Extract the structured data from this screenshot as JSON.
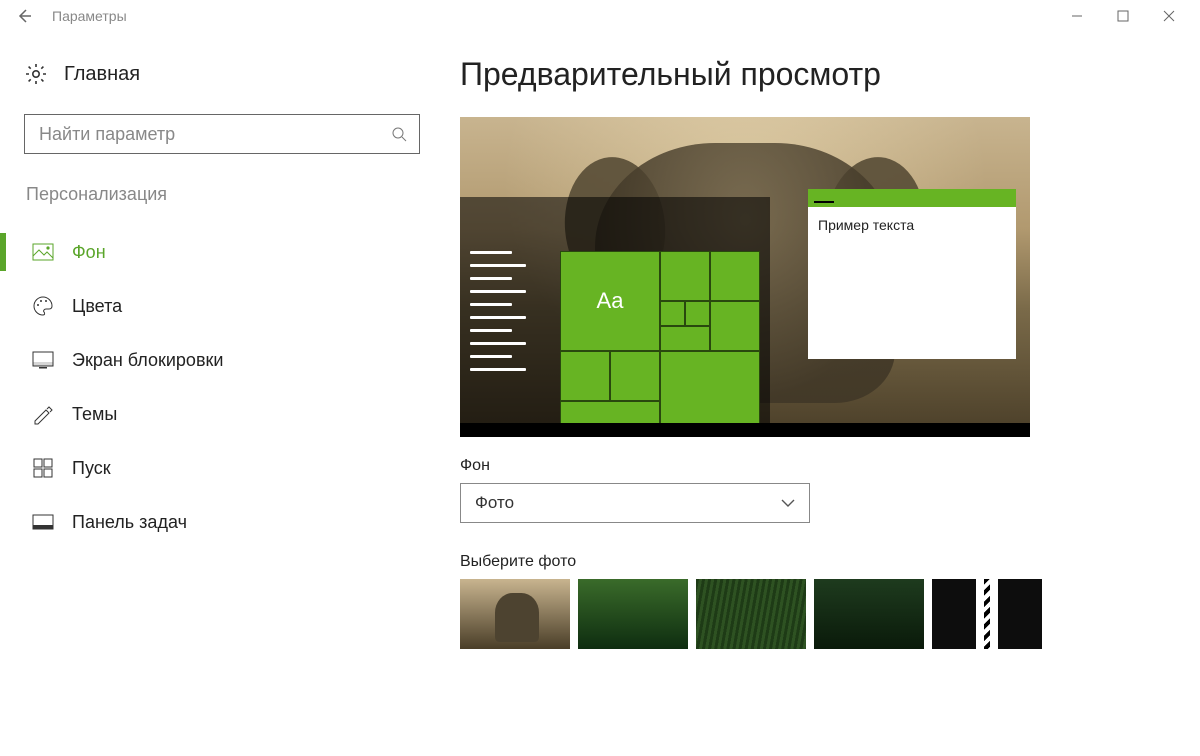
{
  "window": {
    "title": "Параметры"
  },
  "sidebar": {
    "home": "Главная",
    "search_placeholder": "Найти параметр",
    "section": "Персонализация",
    "items": [
      {
        "label": "Фон"
      },
      {
        "label": "Цвета"
      },
      {
        "label": "Экран блокировки"
      },
      {
        "label": "Темы"
      },
      {
        "label": "Пуск"
      },
      {
        "label": "Панель задач"
      }
    ]
  },
  "content": {
    "heading": "Предварительный просмотр",
    "preview_sample_text": "Пример текста",
    "preview_tile_aa": "Aa",
    "background_label": "Фон",
    "background_select_value": "Фото",
    "choose_photo_label": "Выберите фото"
  }
}
